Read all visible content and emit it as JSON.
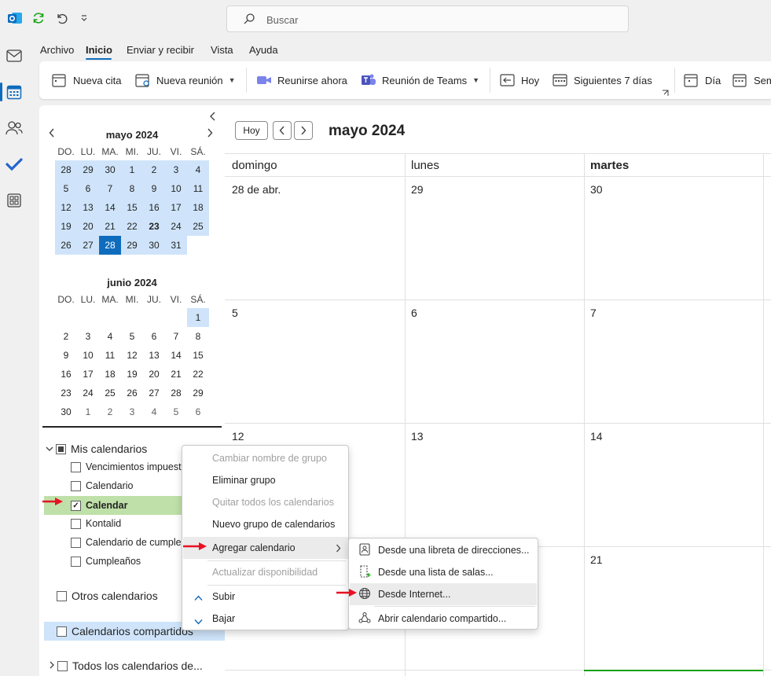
{
  "colors": {
    "accent": "#0f6cbd",
    "highlight_row": "#bfe0a8",
    "arrow_red": "#e81123"
  },
  "search": {
    "placeholder": "Buscar"
  },
  "tabs": [
    "Archivo",
    "Inicio",
    "Enviar y recibir",
    "Vista",
    "Ayuda"
  ],
  "ribbon": {
    "new_appointment": "Nueva cita",
    "new_meeting": "Nueva reunión",
    "meet_now": "Reunirse ahora",
    "teams_meeting": "Reunión de Teams",
    "today": "Hoy",
    "next_7_days": "Siguientes 7 días",
    "day": "Día",
    "week_partial": "Sem"
  },
  "mini_may": {
    "title": "mayo 2024",
    "dows": [
      "DO.",
      "LU.",
      "MA.",
      "MI.",
      "JU.",
      "VI.",
      "SÁ."
    ],
    "weeks": [
      [
        "28",
        "29",
        "30",
        "1",
        "2",
        "3",
        "4"
      ],
      [
        "5",
        "6",
        "7",
        "8",
        "9",
        "10",
        "11"
      ],
      [
        "12",
        "13",
        "14",
        "15",
        "16",
        "17",
        "18"
      ],
      [
        "19",
        "20",
        "21",
        "22",
        "23",
        "24",
        "25"
      ],
      [
        "26",
        "27",
        "28",
        "29",
        "30",
        "31",
        ""
      ]
    ]
  },
  "mini_jun": {
    "title": "junio 2024",
    "dows": [
      "DO.",
      "LU.",
      "MA.",
      "MI.",
      "JU.",
      "VI.",
      "SÁ."
    ],
    "weeks": [
      [
        "",
        "",
        "",
        "",
        "",
        "",
        "1"
      ],
      [
        "2",
        "3",
        "4",
        "5",
        "6",
        "7",
        "8"
      ],
      [
        "9",
        "10",
        "11",
        "12",
        "13",
        "14",
        "15"
      ],
      [
        "16",
        "17",
        "18",
        "19",
        "20",
        "21",
        "22"
      ],
      [
        "23",
        "24",
        "25",
        "26",
        "27",
        "28",
        "29"
      ],
      [
        "30",
        "1",
        "2",
        "3",
        "4",
        "5",
        "6"
      ]
    ]
  },
  "calendars": {
    "my_group": "Mis calendarios",
    "items": [
      {
        "label": "Vencimientos impuestos",
        "checked": false
      },
      {
        "label": "Calendario",
        "checked": false
      },
      {
        "label": "Calendar",
        "checked": true
      },
      {
        "label": "Kontalid",
        "checked": false
      },
      {
        "label": "Calendario de cumpleaños",
        "checked": false
      },
      {
        "label": "Cumpleaños",
        "checked": false
      }
    ],
    "other_group": "Otros calendarios",
    "shared_group": "Calendarios compartidos",
    "all_group": "Todos los calendarios de..."
  },
  "main": {
    "today_button": "Hoy",
    "month_title": "mayo 2024",
    "col_headers": [
      "domingo",
      "lunes",
      "martes"
    ],
    "rows": [
      [
        "28 de abr.",
        "29",
        "30"
      ],
      [
        "5",
        "6",
        "7"
      ],
      [
        "12",
        "13",
        "14"
      ],
      [
        "",
        "",
        "21"
      ]
    ]
  },
  "context_menu": {
    "items": [
      {
        "label": "Cambiar nombre de grupo",
        "disabled": true
      },
      {
        "label": "Eliminar grupo",
        "disabled": false
      },
      {
        "label": "Quitar todos los calendarios",
        "disabled": true
      },
      {
        "label": "Nuevo grupo de calendarios",
        "disabled": false
      },
      {
        "label": "Agregar calendario",
        "disabled": false
      },
      {
        "label": "Actualizar disponibilidad",
        "disabled": true
      },
      {
        "label": "Subir",
        "disabled": false
      },
      {
        "label": "Bajar",
        "disabled": false
      }
    ]
  },
  "submenu": {
    "items": [
      "Desde una libreta de direcciones...",
      "Desde una lista de salas...",
      "Desde Internet...",
      "Abrir calendario compartido..."
    ]
  }
}
